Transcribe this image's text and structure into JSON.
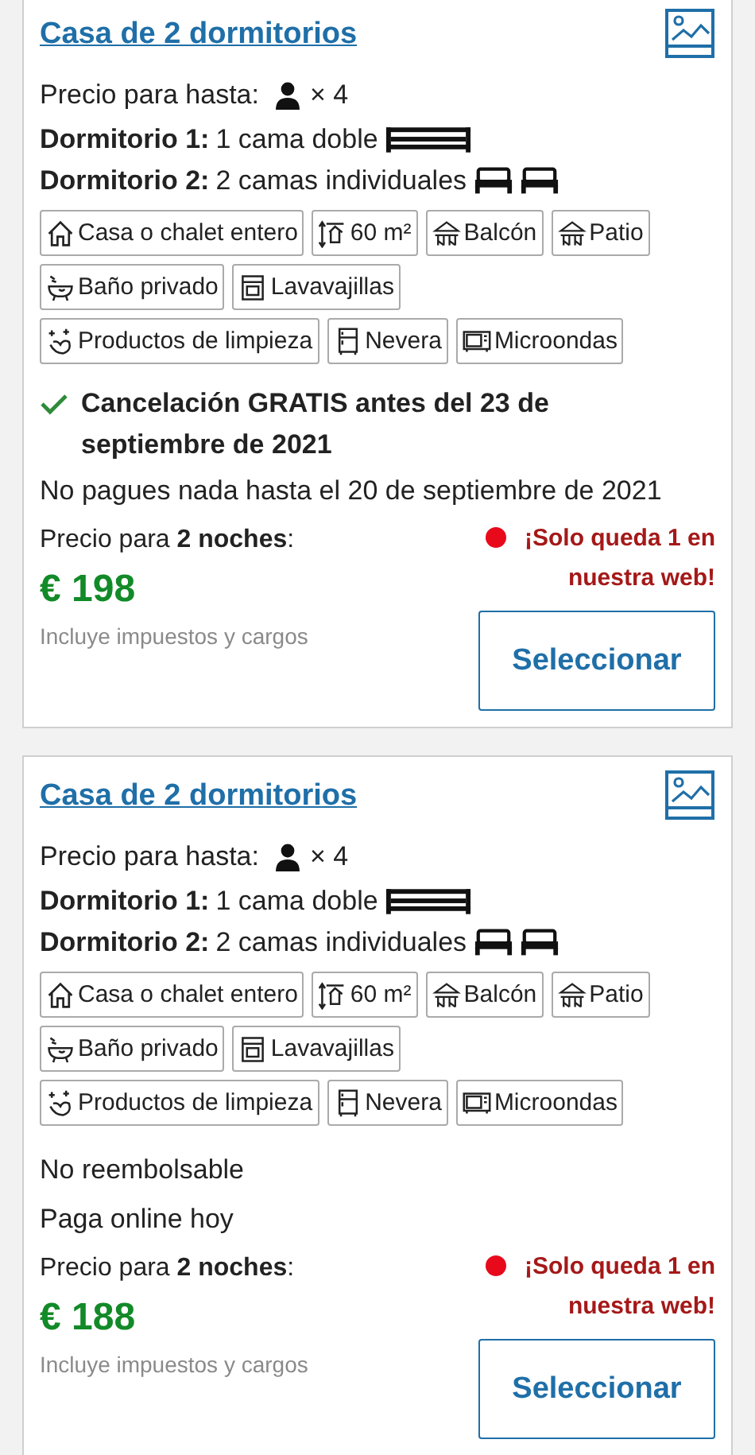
{
  "cards": [
    {
      "title": "Casa de 2 dormitorios",
      "occupancy_label": "Precio para hasta:",
      "occupancy_count": "× 4",
      "bedrooms": [
        {
          "label": "Dormitorio 1:",
          "beds": "1 cama doble",
          "bed_icons": [
            {
              "kind": "double"
            }
          ]
        },
        {
          "label": "Dormitorio 2:",
          "beds": "2 camas individuales",
          "bed_icons": [
            {
              "kind": "single"
            },
            {
              "kind": "single"
            }
          ]
        }
      ],
      "facilities": [
        [
          {
            "kind": "house",
            "label": "Casa o chalet entero"
          },
          {
            "kind": "area",
            "label": "60 m²"
          },
          {
            "kind": "balcony",
            "label": "Balcón"
          },
          {
            "kind": "balcony",
            "label": "Patio"
          }
        ],
        [
          {
            "kind": "bath",
            "label": "Baño privado"
          },
          {
            "kind": "dishwasher",
            "label": "Lavavajillas"
          }
        ],
        [
          {
            "kind": "cleaning",
            "label": "Productos de limpieza"
          },
          {
            "kind": "fridge",
            "label": "Nevera"
          },
          {
            "kind": "microwave",
            "label": "Microondas"
          }
        ]
      ],
      "policies": [
        {
          "kind": "free_cancellation",
          "text": "Cancelación GRATIS antes del 23 de septiembre de 2021"
        },
        {
          "kind": "plain",
          "text": "No pagues nada hasta el 20 de septiembre de 2021"
        }
      ],
      "price_label": "Precio para **2 noches**:",
      "price": "€ 198",
      "price_note": "Incluye impuestos y cargos",
      "scarcity": "¡Solo queda 1 en nuestra web!",
      "button": "Seleccionar"
    },
    {
      "title": "Casa de 2 dormitorios",
      "occupancy_label": "Precio para hasta:",
      "occupancy_count": "× 4",
      "bedrooms": [
        {
          "label": "Dormitorio 1:",
          "beds": "1 cama doble",
          "bed_icons": [
            {
              "kind": "double"
            }
          ]
        },
        {
          "label": "Dormitorio 2:",
          "beds": "2 camas individuales",
          "bed_icons": [
            {
              "kind": "single"
            },
            {
              "kind": "single"
            }
          ]
        }
      ],
      "facilities": [
        [
          {
            "kind": "house",
            "label": "Casa o chalet entero"
          },
          {
            "kind": "area",
            "label": "60 m²"
          },
          {
            "kind": "balcony",
            "label": "Balcón"
          },
          {
            "kind": "balcony",
            "label": "Patio"
          }
        ],
        [
          {
            "kind": "bath",
            "label": "Baño privado"
          },
          {
            "kind": "dishwasher",
            "label": "Lavavajillas"
          }
        ],
        [
          {
            "kind": "cleaning",
            "label": "Productos de limpieza"
          },
          {
            "kind": "fridge",
            "label": "Nevera"
          },
          {
            "kind": "microwave",
            "label": "Microondas"
          }
        ]
      ],
      "policies": [
        {
          "kind": "plain",
          "text": "No reembolsable"
        },
        {
          "kind": "plain",
          "text": "Paga online hoy"
        }
      ],
      "price_label": "Precio para **2 noches**:",
      "price": "€ 188",
      "price_note": "Incluye impuestos y cargos",
      "scarcity": "¡Solo queda 1 en nuestra web!",
      "button": "Seleccionar"
    }
  ]
}
